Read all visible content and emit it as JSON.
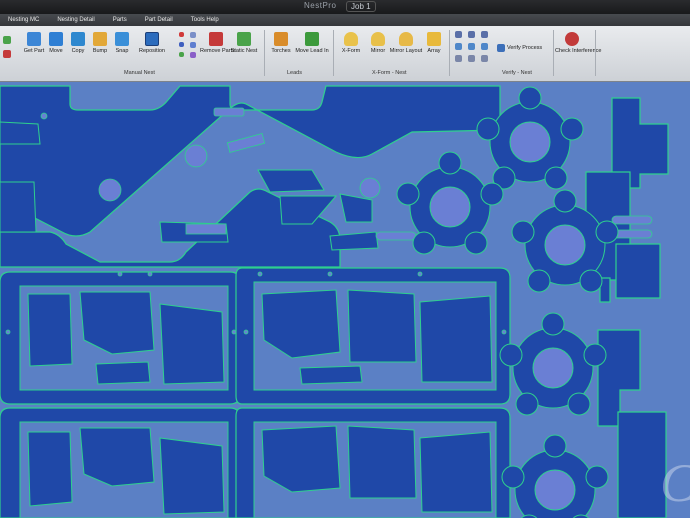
{
  "titlebar": {
    "app_name": "NestPro",
    "doc_label": "Job 1"
  },
  "menu": [
    "Nesting MC",
    "Nesting Detail",
    "Parts",
    "Part Detail",
    "Tools Help"
  ],
  "ribbon": {
    "tools": [
      {
        "id": "get-part",
        "label": "Get Part",
        "color": "#3c86d6"
      },
      {
        "id": "move",
        "label": "Move",
        "color": "#2f7fd4"
      },
      {
        "id": "copy",
        "label": "Copy",
        "color": "#2e88cf"
      },
      {
        "id": "bump",
        "label": "Bump",
        "color": "#e2a838"
      },
      {
        "id": "snap",
        "label": "Snap",
        "color": "#3a8fd8"
      },
      {
        "id": "reposition",
        "label": "Reposition",
        "color": "#2c6cbd"
      },
      {
        "id": "remove-parts",
        "label": "Remove Parts",
        "color": "#c53a3a"
      },
      {
        "id": "static-nest",
        "label": "Static Nest",
        "color": "#4aa34a"
      },
      {
        "id": "torches",
        "label": "Torches",
        "color": "#d98c2a"
      },
      {
        "id": "move-lead-in",
        "label": "Move Lead In",
        "color": "#3c9a3c"
      },
      {
        "id": "x-form",
        "label": "X-Form",
        "color": "#e9c24b"
      },
      {
        "id": "mirror",
        "label": "Mirror",
        "color": "#e8c04a"
      },
      {
        "id": "mirror-layout",
        "label": "Mirror Layout",
        "color": "#e7b947"
      },
      {
        "id": "array",
        "label": "Array",
        "color": "#e8b93b"
      },
      {
        "id": "verify-process",
        "label": "Verify Process",
        "color": "#3c6fb9"
      },
      {
        "id": "check-interference",
        "label": "Check Interference",
        "color": "#c23a3a"
      }
    ],
    "groups": [
      "Manual Nest",
      "Leads",
      "X-Form - Nest",
      "Verify - Nest"
    ]
  },
  "colors": {
    "plate": "#5b80c5",
    "part": "#1f48a8",
    "cut_path": "#2ed08e",
    "hole": "#6a7fd4"
  },
  "watermark": "C"
}
